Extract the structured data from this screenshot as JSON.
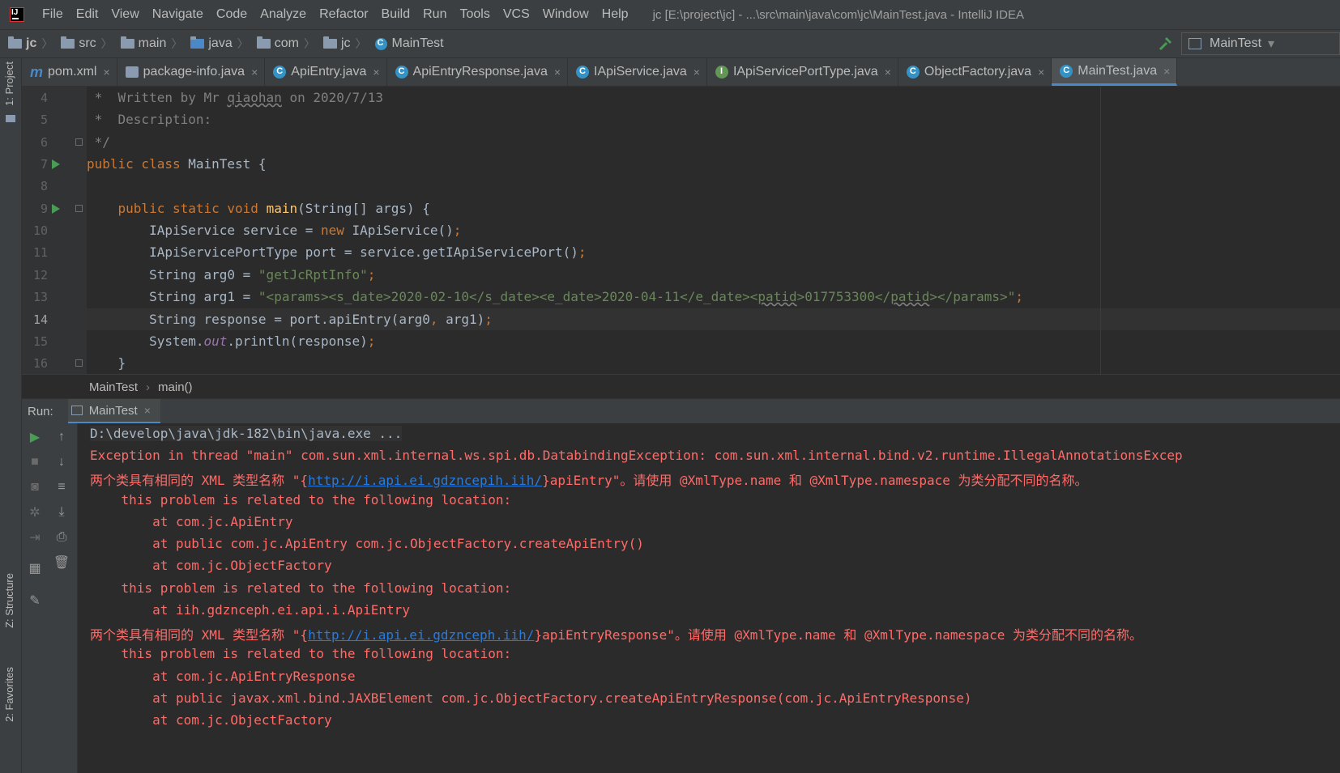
{
  "menubar": {
    "items": [
      "File",
      "Edit",
      "View",
      "Navigate",
      "Code",
      "Analyze",
      "Refactor",
      "Build",
      "Run",
      "Tools",
      "VCS",
      "Window",
      "Help"
    ],
    "window_title": "jc [E:\\project\\jc] - ...\\src\\main\\java\\com\\jc\\MainTest.java - IntelliJ IDEA"
  },
  "navbar": {
    "crumbs": [
      "jc",
      "src",
      "main",
      "java",
      "com",
      "jc",
      "MainTest"
    ],
    "run_config": "MainTest"
  },
  "left_strip": {
    "project": "1: Project",
    "structure": "Z: Structure",
    "favorites": "2: Favorites"
  },
  "tabs": [
    {
      "label": "pom.xml"
    },
    {
      "label": "package-info.java"
    },
    {
      "label": "ApiEntry.java"
    },
    {
      "label": "ApiEntryResponse.java"
    },
    {
      "label": "IApiService.java"
    },
    {
      "label": "IApiServicePortType.java"
    },
    {
      "label": "ObjectFactory.java"
    },
    {
      "label": "MainTest.java"
    }
  ],
  "editor": {
    "line_numbers": [
      "4",
      "5",
      "6",
      "7",
      "8",
      "9",
      "10",
      "11",
      "12",
      "13",
      "14",
      "15",
      "16"
    ],
    "current_line": "14",
    "code": {
      "l4a": " *  Written by Mr ",
      "l4b": "qiaohan",
      "l4c": " on 2020/7/13",
      "l5": " *  Description:",
      "l6": " */",
      "l7a": "public class ",
      "l7b": "MainTest {",
      "l9a": "    public static void ",
      "l9b": "main",
      "l9c": "(String[] args) {",
      "l10a": "        IApiService service = ",
      "l10b": "new ",
      "l10c": "IApiService()",
      "l10d": ";",
      "l11a": "        IApiServicePortType port = service.getIApiServicePort()",
      "l11b": ";",
      "l12a": "        String arg0 = ",
      "l12b": "\"getJcRptInfo\"",
      "l12c": ";",
      "l13a": "        String arg1 = ",
      "l13b": "\"<params><s_date>2020-02-10</s_date><e_date>2020-04-11</e_date><",
      "l13c": "patid",
      "l13d": ">017753300</",
      "l13e": "patid",
      "l13f": "></params>\"",
      "l13g": ";",
      "l14a": "        String response = port.apiEntry(arg0",
      "l14b": ", ",
      "l14c": "arg1)",
      "l14d": ";",
      "l15a": "        System.",
      "l15b": "out",
      "l15c": ".println(response)",
      "l15d": ";",
      "l16": "    }"
    }
  },
  "editor_crumb": {
    "class": "MainTest",
    "method": "main()"
  },
  "run": {
    "title": "Run:",
    "tab": "MainTest",
    "console": {
      "cmd": "D:\\develop\\java\\jdk-182\\bin\\java.exe ...",
      "c1": "Exception in thread \"main\" com.sun.xml.internal.ws.spi.db.DatabindingException: com.sun.xml.internal.bind.v2.runtime.IllegalAnnotationsExcep",
      "c2a": "两个类具有相同的 XML 类型名称 \"{",
      "c2b": "http://i.api.ei.gdzncepih.iih/",
      "c2c": "}apiEntry\"。请使用 @XmlType.name 和 @XmlType.namespace 为类分配不同的名称。",
      "c3": "    this problem is related to the following location:",
      "c4": "        at com.jc.ApiEntry",
      "c5": "        at public com.jc.ApiEntry com.jc.ObjectFactory.createApiEntry()",
      "c6": "        at com.jc.ObjectFactory",
      "c7": "    this problem is related to the following location:",
      "c8": "        at iih.gdznceph.ei.api.i.ApiEntry",
      "c9a": "两个类具有相同的 XML 类型名称 \"{",
      "c9b": "http://i.api.ei.gdznceph.iih/",
      "c9c": "}apiEntryResponse\"。请使用 @XmlType.name 和 @XmlType.namespace 为类分配不同的名称。",
      "c10": "    this problem is related to the following location:",
      "c11": "        at com.jc.ApiEntryResponse",
      "c12": "        at public javax.xml.bind.JAXBElement com.jc.ObjectFactory.createApiEntryResponse(com.jc.ApiEntryResponse)",
      "c13": "        at com.jc.ObjectFactory"
    }
  },
  "colors": {
    "accent": "#4a88c7",
    "error": "#ff6b68",
    "keyword": "#cc7832",
    "string": "#6a8759",
    "run_green": "#499c54"
  }
}
